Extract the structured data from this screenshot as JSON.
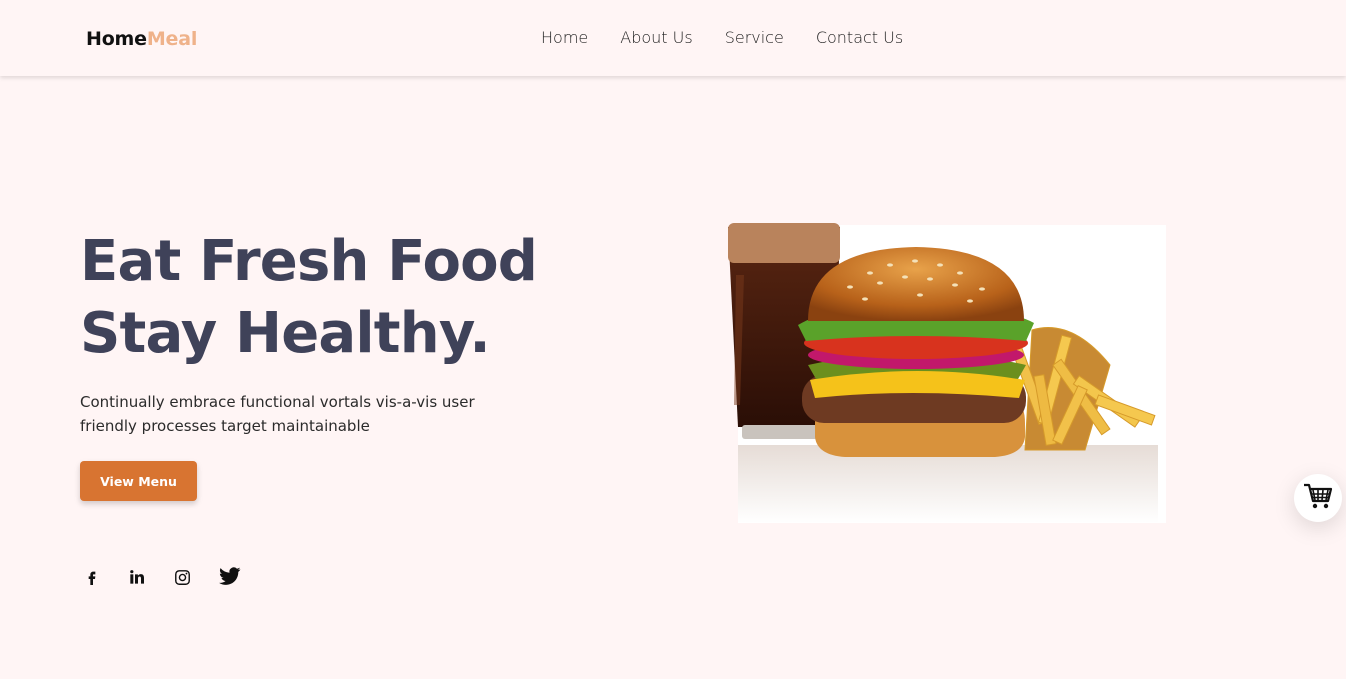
{
  "brand": {
    "primary": "Home",
    "accent": "Meal",
    "accent_color": "#efb28a"
  },
  "nav": {
    "items": [
      {
        "label": "Home"
      },
      {
        "label": "About Us"
      },
      {
        "label": "Service"
      },
      {
        "label": "Contact Us"
      }
    ]
  },
  "hero": {
    "title_line1": "Eat Fresh Food",
    "title_line2": "Stay Healthy.",
    "description": "Continually embrace functional vortals vis-a-vis user friendly processes target maintainable",
    "cta_label": "View Menu",
    "cta_color": "#d87431",
    "image_icon": "burger-fries-cola-image"
  },
  "socials": [
    {
      "icon": "facebook-icon"
    },
    {
      "icon": "linkedin-icon"
    },
    {
      "icon": "instagram-icon"
    },
    {
      "icon": "twitter-icon"
    }
  ],
  "cart": {
    "icon": "shopping-cart-icon"
  },
  "colors": {
    "background": "#fff5f5",
    "heading": "#3f4259"
  }
}
